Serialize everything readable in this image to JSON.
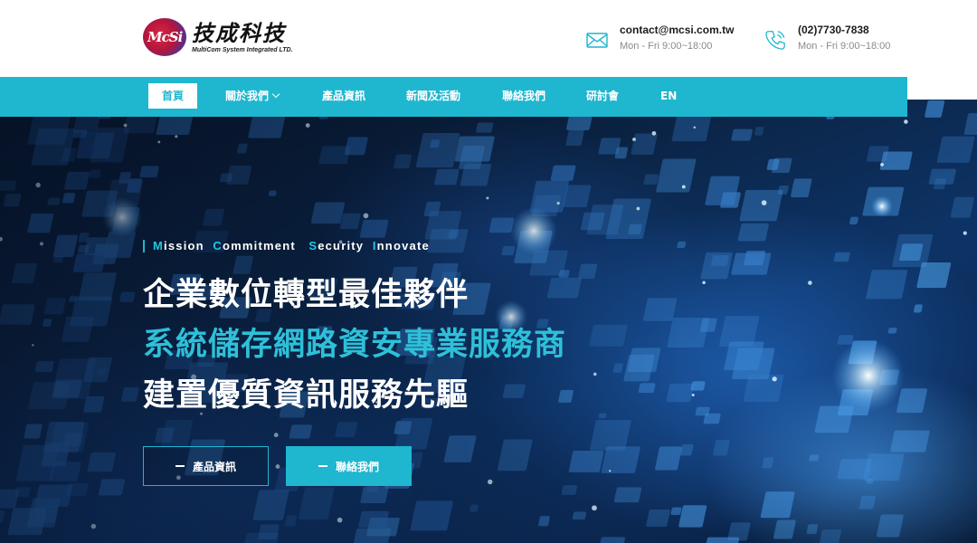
{
  "header": {
    "logo_mark_text": "McSi",
    "logo_cn": "技成科技",
    "logo_en": "MultiCom System Integrated LTD.",
    "email": {
      "icon": "mail-icon",
      "value": "contact@mcsi.com.tw",
      "hours": "Mon - Fri 9:00~18:00"
    },
    "phone": {
      "icon": "phone-icon",
      "value": "(02)7730-7838",
      "hours": "Mon - Fri 9:00~18:00"
    }
  },
  "nav": {
    "items": [
      {
        "label": "首頁",
        "active": true
      },
      {
        "label": "關於我們",
        "has_dropdown": true
      },
      {
        "label": "產品資訊"
      },
      {
        "label": "新聞及活動"
      },
      {
        "label": "聯絡我們"
      },
      {
        "label": "研討會"
      },
      {
        "label": "EN"
      }
    ]
  },
  "hero": {
    "tagline_words": [
      {
        "cap": "M",
        "rest": "ission"
      },
      {
        "cap": "C",
        "rest": "ommitment"
      },
      {
        "cap": "S",
        "rest": "ecurity"
      },
      {
        "cap": "I",
        "rest": "nnovate"
      }
    ],
    "line1": "企業數位轉型最佳夥伴",
    "line2": "系統儲存網路資安專業服務商",
    "line3": "建置優質資訊服務先驅",
    "buttons": [
      {
        "label": "產品資訊"
      },
      {
        "label": "聯絡我們"
      }
    ]
  },
  "colors": {
    "accent": "#1fb6cf",
    "nav_bg": "#1fb6cf",
    "hero_dark": "#0b2547",
    "headline_accent": "#2ec0d8"
  }
}
